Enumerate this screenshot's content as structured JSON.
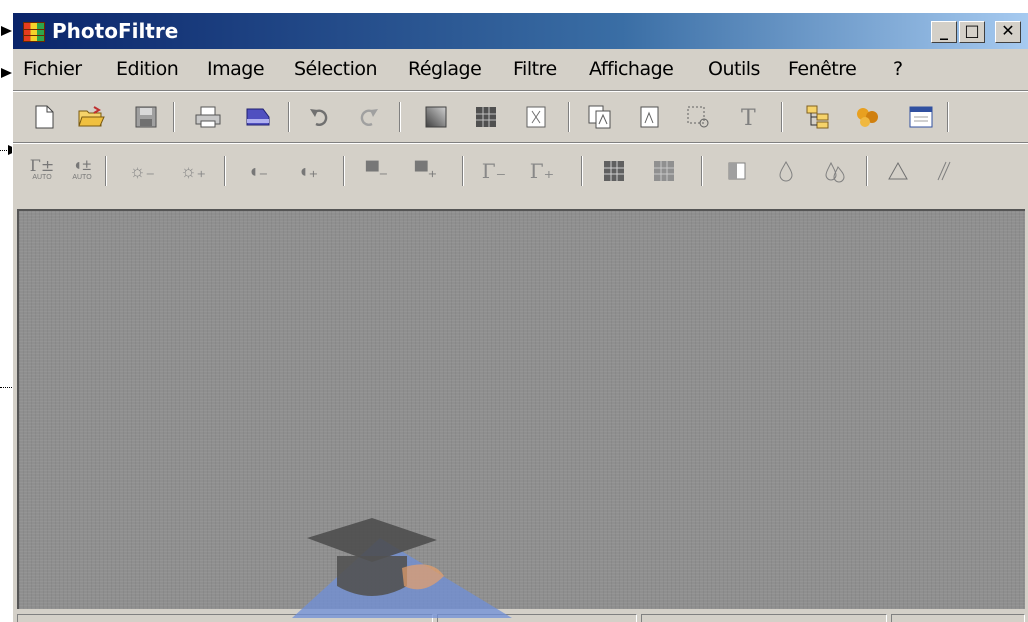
{
  "window": {
    "title": "PhotoFiltre",
    "controls": {
      "minimize": "_",
      "maximize": "□",
      "close": "✕"
    }
  },
  "menu": {
    "items": [
      "Fichier",
      "Edition",
      "Image",
      "Sélection",
      "Réglage",
      "Filtre",
      "Affichage",
      "Outils",
      "Fenêtre",
      "?"
    ]
  },
  "toolbar_main": {
    "icons": [
      "new-document-icon",
      "open-folder-icon",
      "save-icon",
      "print-icon",
      "scanner-icon",
      "undo-icon",
      "redo-icon",
      "gradient-fill-icon",
      "grid-icon",
      "transparency-icon",
      "copy-image-icon",
      "paste-image-icon",
      "selection-icon",
      "text-icon",
      "explorer-icon",
      "puzzle-icon",
      "window-icon"
    ]
  },
  "toolbar_adjust": {
    "icons": [
      "auto-levels-icon",
      "auto-contrast-icon",
      "brightness-minus-icon",
      "brightness-plus-icon",
      "contrast-minus-icon",
      "contrast-plus-icon",
      "saturation-minus-icon",
      "saturation-plus-icon",
      "gamma-minus-icon",
      "gamma-plus-icon",
      "grid-dark-icon",
      "grid-light-icon",
      "dodge-icon",
      "drop-icon",
      "drops-icon",
      "triangle-icon",
      "smudge-icon"
    ],
    "labels": {
      "auto": "AUTO"
    }
  },
  "colors": {
    "titlebar_start": "#0a246a",
    "titlebar_end": "#a6caf0",
    "chrome": "#d4d0c8",
    "workspace": "#8f8f8f"
  }
}
